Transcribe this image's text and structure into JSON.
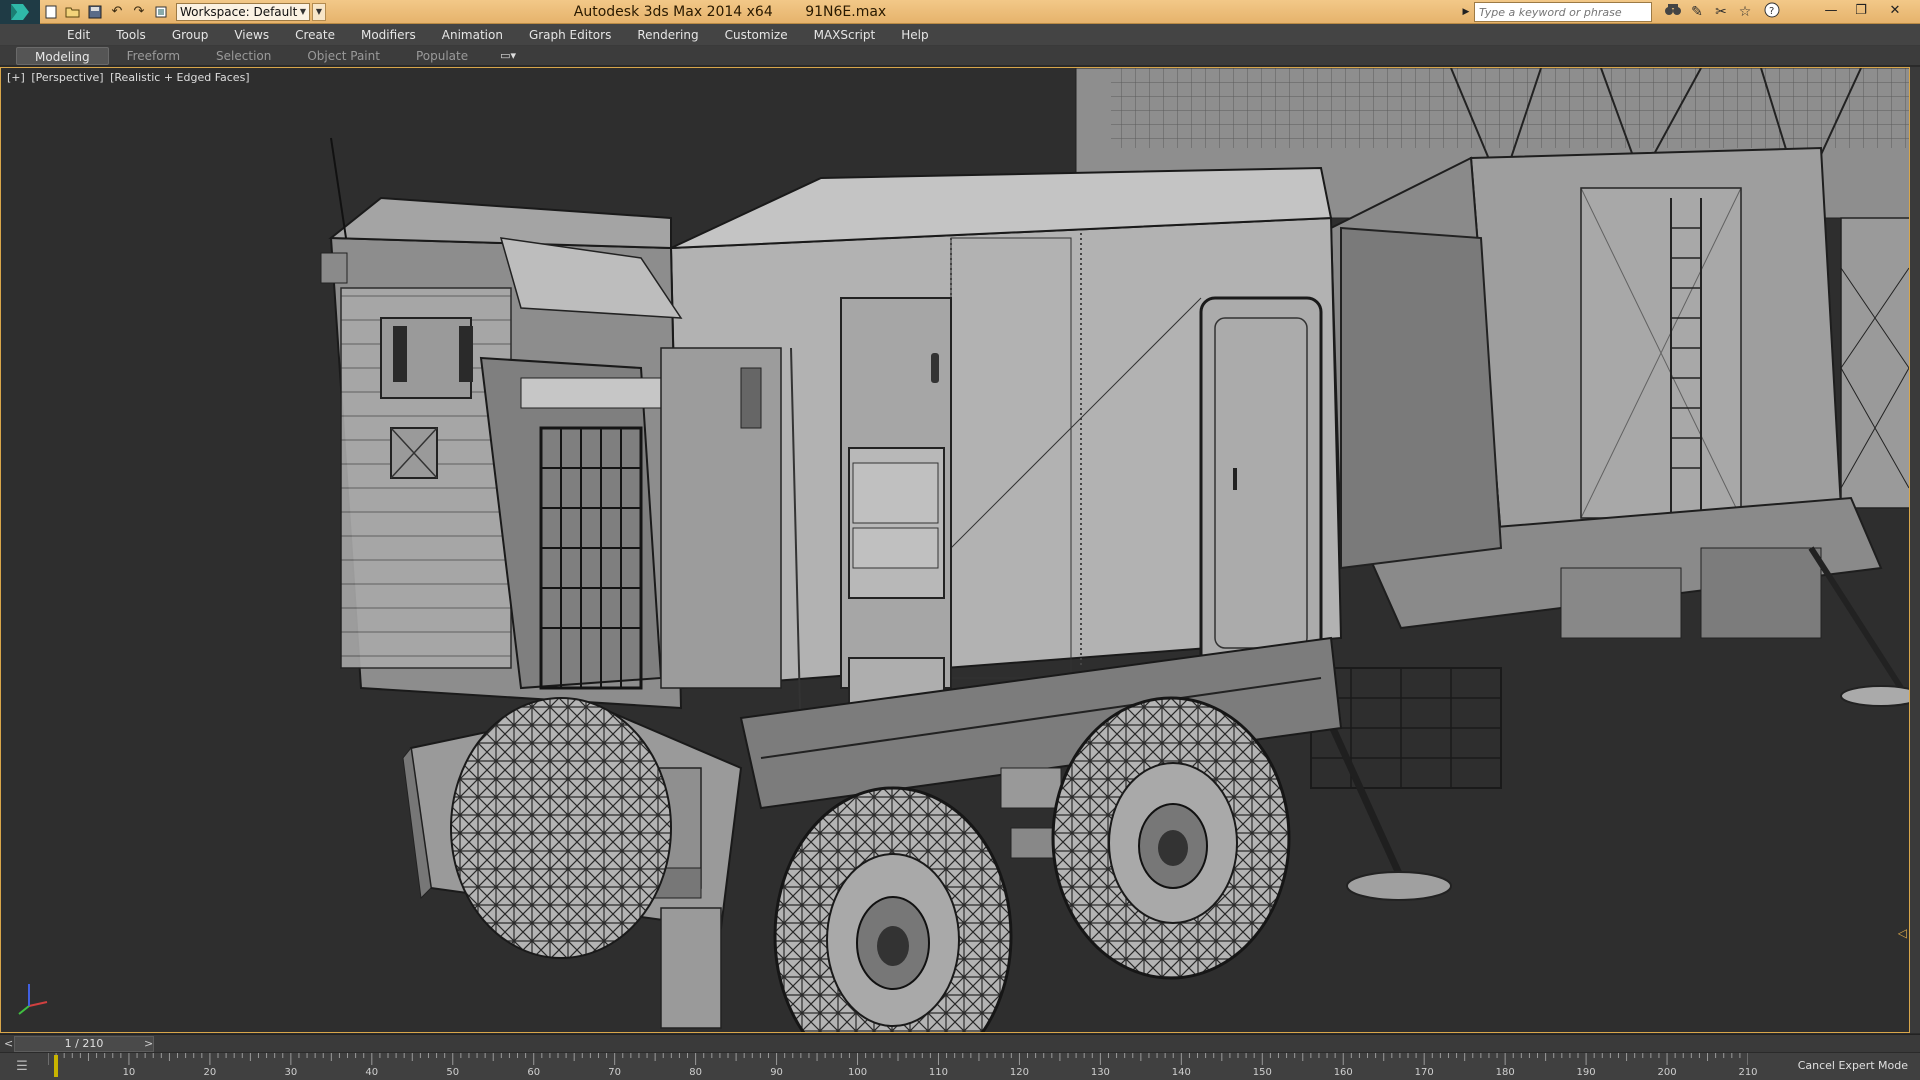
{
  "titlebar": {
    "app_title": "Autodesk 3ds Max  2014 x64",
    "file_name": "91N6E.max",
    "workspace_label": "Workspace: Default",
    "search_placeholder": "Type a keyword or phrase",
    "accent_color": "#e6b36c"
  },
  "menubar": {
    "items": [
      "Edit",
      "Tools",
      "Group",
      "Views",
      "Create",
      "Modifiers",
      "Animation",
      "Graph Editors",
      "Rendering",
      "Customize",
      "MAXScript",
      "Help"
    ]
  },
  "ribbon": {
    "tabs": [
      {
        "label": "Modeling",
        "active": true
      },
      {
        "label": "Freeform",
        "active": false
      },
      {
        "label": "Selection",
        "active": false
      },
      {
        "label": "Object Paint",
        "active": false
      },
      {
        "label": "Populate",
        "active": false
      }
    ]
  },
  "viewport": {
    "label_plus": "[+]",
    "label_view": "[Perspective]",
    "label_shading": "[Realistic + Edged Faces]",
    "border_color": "#d8a64a"
  },
  "timeline": {
    "frame_display": "1 / 210",
    "current_frame": 1,
    "total_frames": 210,
    "ticks": [
      10,
      20,
      30,
      40,
      50,
      60,
      70,
      80,
      90,
      100,
      110,
      120,
      130,
      140,
      150,
      160,
      170,
      180,
      190,
      200,
      210
    ],
    "cancel_expert_label": "Cancel Expert Mode"
  },
  "icons": {
    "quick_access": [
      "new-file-icon",
      "open-file-icon",
      "save-icon",
      "undo-icon",
      "redo-icon",
      "project-icon"
    ],
    "toolbar_right": [
      "binoculars-icon",
      "tools-icon",
      "connect-icon",
      "favorites-star-icon",
      "help-icon"
    ]
  }
}
